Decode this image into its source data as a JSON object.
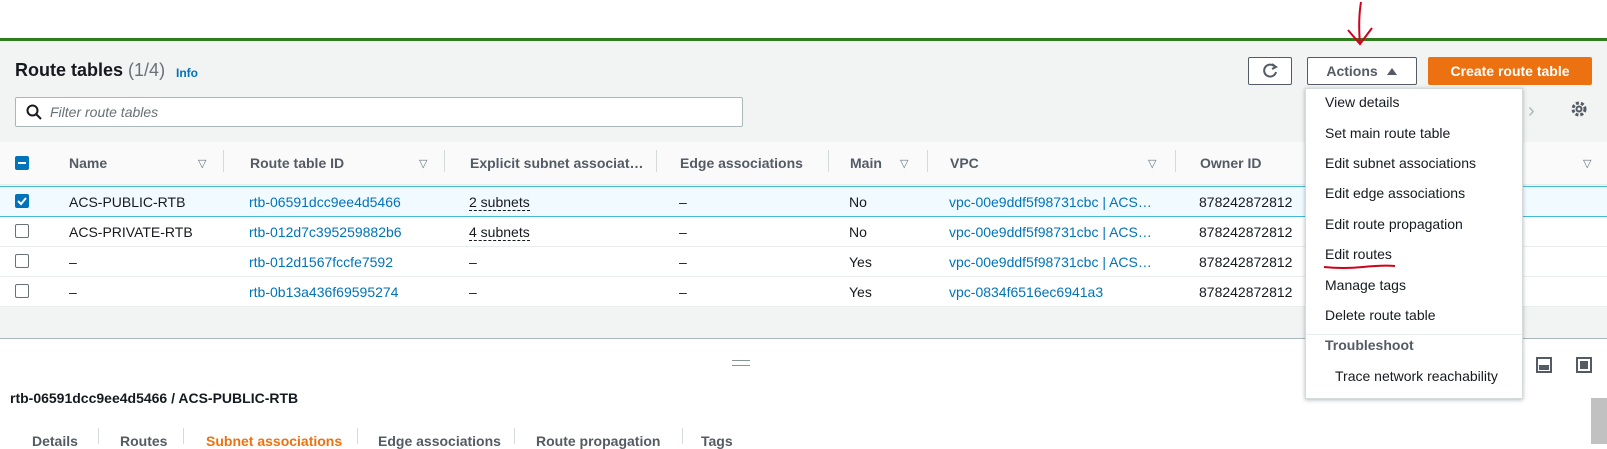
{
  "header": {
    "title": "Route tables",
    "count": "(1/4)",
    "info_label": "Info",
    "actions_label": "Actions",
    "create_label": "Create route table"
  },
  "search": {
    "placeholder": "Filter route tables"
  },
  "table": {
    "columns": [
      "Name",
      "Route table ID",
      "Explicit subnet associat…",
      "Edge associations",
      "Main",
      "VPC",
      "Owner ID"
    ],
    "rows": [
      {
        "name": "ACS-PUBLIC-RTB",
        "id": "rtb-06591dcc9ee4d5466",
        "subnets": "2 subnets",
        "edge": "–",
        "main": "No",
        "vpc": "vpc-00e9ddf5f98731cbc | ACS…",
        "owner": "878242872812",
        "selected": true
      },
      {
        "name": "ACS-PRIVATE-RTB",
        "id": "rtb-012d7c395259882b6",
        "subnets": "4 subnets",
        "edge": "–",
        "main": "No",
        "vpc": "vpc-00e9ddf5f98731cbc | ACS…",
        "owner": "878242872812",
        "selected": false
      },
      {
        "name": "–",
        "id": "rtb-012d1567fccfe7592",
        "subnets": "–",
        "edge": "–",
        "main": "Yes",
        "vpc": "vpc-00e9ddf5f98731cbc | ACS…",
        "owner": "878242872812",
        "selected": false
      },
      {
        "name": "–",
        "id": "rtb-0b13a436f69595274",
        "subnets": "–",
        "edge": "–",
        "main": "Yes",
        "vpc": "vpc-0834f6516ec6941a3",
        "owner": "878242872812",
        "selected": false
      }
    ]
  },
  "actions_menu": {
    "items": [
      "View details",
      "Set main route table",
      "Edit subnet associations",
      "Edit edge associations",
      "Edit route propagation",
      "Edit routes",
      "Manage tags",
      "Delete route table"
    ],
    "group_label": "Troubleshoot",
    "group_items": [
      "Trace network reachability"
    ]
  },
  "details": {
    "title": "rtb-06591dcc9ee4d5466 / ACS-PUBLIC-RTB",
    "tabs": [
      "Details",
      "Routes",
      "Subnet associations",
      "Edge associations",
      "Route propagation",
      "Tags"
    ],
    "active_tab": "Subnet associations"
  },
  "colors": {
    "accent": "#ec7211",
    "link": "#0073bb",
    "annotation": "#d0021b",
    "top_border": "#2e7d1e"
  }
}
